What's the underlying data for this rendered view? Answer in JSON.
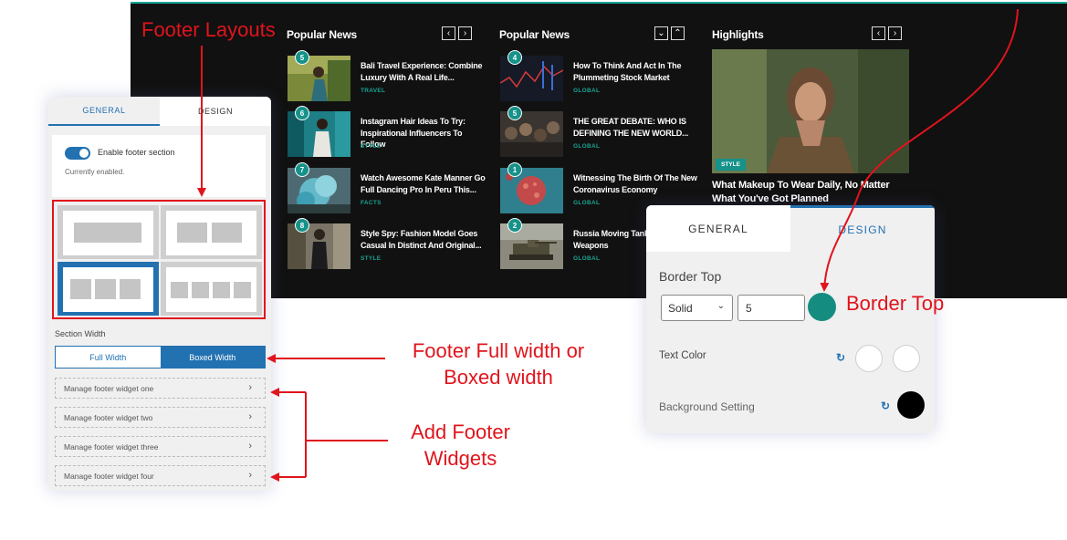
{
  "preview": {
    "col1": {
      "title": "Popular News",
      "nav": [
        "‹",
        "›"
      ],
      "items": [
        {
          "num": "5",
          "title": "Bali Travel Experience: Combine Luxury With A Real Life...",
          "category": "TRAVEL"
        },
        {
          "num": "6",
          "title": "Instagram Hair Ideas To Try: Inspirational Influencers To Follow",
          "category": "STYLE"
        },
        {
          "num": "7",
          "title": "Watch Awesome Kate Manner Go Full Dancing Pro In Peru This...",
          "category": "FACTS"
        },
        {
          "num": "8",
          "title": "Style Spy: Fashion Model Goes Casual In Distinct And Original...",
          "category": "STYLE"
        }
      ]
    },
    "col2": {
      "title": "Popular News",
      "nav": [
        "⌄",
        "⌃"
      ],
      "items": [
        {
          "num": "4",
          "title": "How To Think And Act In The Plummeting Stock Market",
          "category": "GLOBAL"
        },
        {
          "num": "5",
          "title": "THE GREAT DEBATE: WHO IS DEFINING THE NEW WORLD...",
          "category": "GLOBAL"
        },
        {
          "num": "1",
          "title": "Witnessing The Birth Of The New Coronavirus Economy",
          "category": "GLOBAL"
        },
        {
          "num": "2",
          "title": "Russia Moving Tank A Nuclear Weapons",
          "category": "GLOBAL"
        }
      ]
    },
    "col3": {
      "title": "Highlights",
      "nav": [
        "‹",
        "›"
      ],
      "category": "STYLE",
      "headline": "What Makeup To Wear Daily, No Matter What You've Got Planned"
    },
    "colors": {
      "background": "#111111",
      "accent": "#18a395"
    }
  },
  "left_panel": {
    "tabs": {
      "general": "GENERAL",
      "design": "DESIGN"
    },
    "toggle_label": "Enable footer section",
    "toggle_status": "Currently enabled.",
    "toggle_on": true,
    "layouts": [
      "single-column",
      "two-columns",
      "three-columns",
      "four-columns"
    ],
    "selected_layout": "three-columns",
    "section_width_label": "Section Width",
    "width_options": {
      "full": "Full Width",
      "boxed": "Boxed Width"
    },
    "selected_width": "Boxed Width",
    "widgets": [
      "Manage footer widget one",
      "Manage footer widget two",
      "Manage footer widget three",
      "Manage footer widget four"
    ],
    "chevron": "›"
  },
  "right_panel": {
    "tabs": {
      "general": "GENERAL",
      "design": "DESIGN"
    },
    "border_top_label": "Border Top",
    "border_style": "Solid",
    "border_width": "5",
    "border_color": "#158c80",
    "text_color_label": "Text Color",
    "text_colors": [
      "#ffffff",
      "#ffffff"
    ],
    "background_label": "Background Setting",
    "background_color": "#000000",
    "reset_icon": "↻"
  },
  "annotations": {
    "footer_layouts": "Footer Layouts",
    "width_line1": "Footer Full width or",
    "width_line2": "Boxed width",
    "widgets_line1": "Add Footer",
    "widgets_line2": "Widgets",
    "border_top": "Border Top",
    "color": "#e0141c"
  }
}
